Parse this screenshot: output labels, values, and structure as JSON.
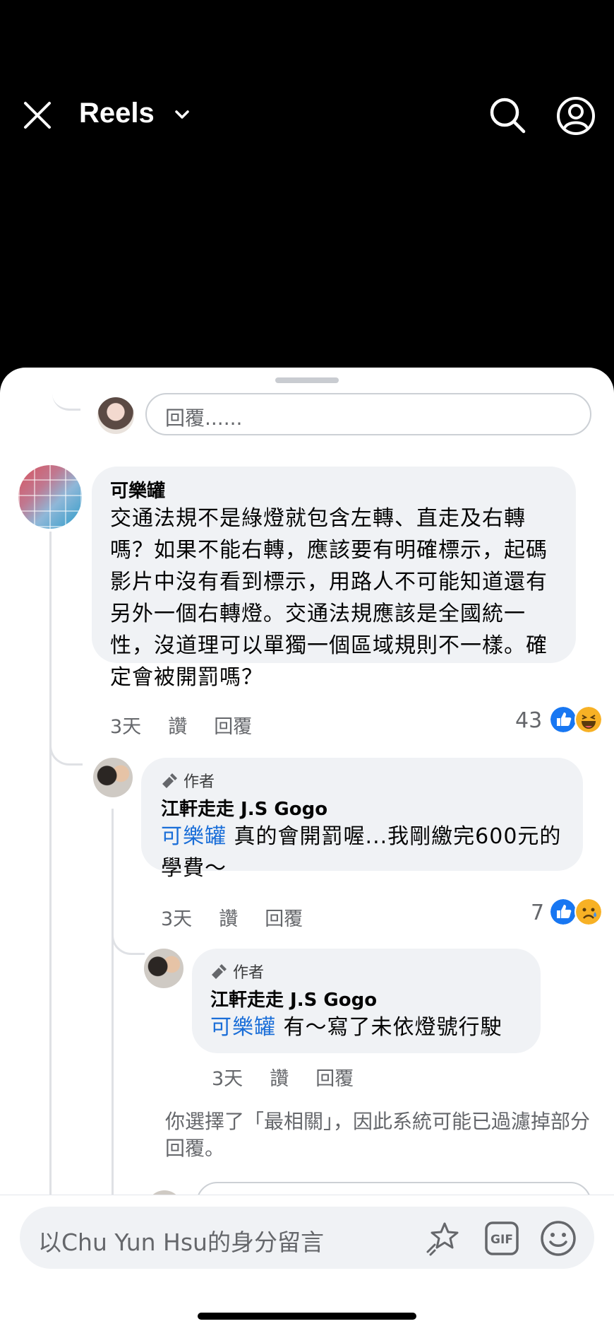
{
  "header": {
    "title": "Reels"
  },
  "reply_placeholder": "回覆......",
  "comments": [
    {
      "name": "可樂罐",
      "text": "交通法規不是綠燈就包含左轉、直走及右轉嗎？如果不能右轉，應該要有明確標示，起碼影片中沒有看到標示，用路人不可能知道還有另外一個右轉燈。交通法規應該是全國統一性，沒道理可以單獨一個區域規則不一樣。確定會被開罰嗎？",
      "time": "3天",
      "like": "讚",
      "reply": "回覆",
      "count": "43"
    },
    {
      "tag": "作者",
      "name": "江軒走走 J.S Gogo",
      "mention": "可樂罐",
      "text": " 真的會開罰喔...我剛繳完600元的學費～",
      "time": "3天",
      "like": "讚",
      "reply": "回覆",
      "count": "7"
    },
    {
      "tag": "作者",
      "name": "江軒走走 J.S Gogo",
      "mention": "可樂罐",
      "text": " 有～寫了未依燈號行駛",
      "time": "3天",
      "like": "讚",
      "reply": "回覆"
    }
  ],
  "notice": "你選擇了「最相關」，因此系統可能已過濾掉部分回覆。",
  "composer": {
    "placeholder": "以Chu Yun Hsu的身分留言"
  },
  "colors": {
    "mention": "#1a6ed8",
    "like": "#1877f2",
    "haha": "#f7b125"
  }
}
